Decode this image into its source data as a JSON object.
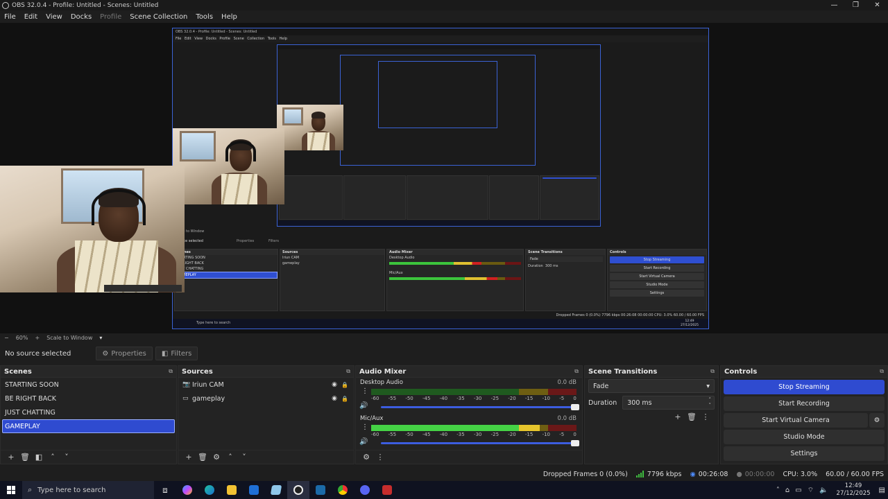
{
  "window": {
    "title": "OBS 32.0.4 - Profile: Untitled - Scenes: Untitled",
    "controls": [
      "—",
      "❐",
      "✕"
    ]
  },
  "menu": {
    "items": [
      "File",
      "Edit",
      "View",
      "Docks",
      "Profile",
      "Scene Collection",
      "Tools",
      "Help"
    ]
  },
  "nested_preview": {
    "title": "OBS 32.0.4 - Profile: Untitled - Scenes: Untitled",
    "menu": "File Edit View Docks Profile Scene Collection Tools Help",
    "zoom": "Scale to Window",
    "no_source": "Source selected",
    "properties": "Properties",
    "filters": "Filters",
    "scenes_header": "Scenes",
    "scenes": [
      "STARTING SOON",
      "BE RIGHT BACK",
      "JUST CHATTING",
      "GAMEPLAY"
    ],
    "sources_header": "Sources",
    "sources": [
      "Iriun CAM",
      "gameplay"
    ],
    "mixer_header": "Audio Mixer",
    "ch1": "Desktop Audio",
    "ch2": "Mic/Aux",
    "db": "0.0 dB",
    "transitions_header": "Scene Transitions",
    "fade": "Fade",
    "duration_label": "Duration",
    "duration_value": "300 ms",
    "controls_header": "Controls",
    "controls": [
      "Stop Streaming",
      "Start Recording",
      "Start Virtual Camera",
      "Studio Mode",
      "Settings"
    ],
    "status": "Dropped Frames 0 (0.0%)   7796 kbps   00:26:08   00:00:00   CPU: 3.0%   60.00 / 60.00 FPS",
    "taskbar_search": "Type here to search",
    "clock_time": "12:49",
    "clock_date": "27/12/2025"
  },
  "zoom_bar": {
    "minus": "−",
    "zoom": "60%",
    "plus": "+",
    "scale_mode": "Scale to Window",
    "dropdown": "▾"
  },
  "selection_bar": {
    "no_source": "No source selected",
    "properties": "Properties",
    "filters": "Filters"
  },
  "scenes": {
    "header": "Scenes",
    "items": [
      "STARTING SOON",
      "BE RIGHT BACK",
      "JUST CHATTING",
      "GAMEPLAY"
    ],
    "selected": "GAMEPLAY"
  },
  "sources": {
    "header": "Sources",
    "items": [
      {
        "name": "Iriun CAM",
        "icon": "camera-icon"
      },
      {
        "name": "gameplay",
        "icon": "monitor-icon"
      }
    ]
  },
  "audio_mixer": {
    "header": "Audio Mixer",
    "ticks": [
      "-60",
      "-55",
      "-50",
      "-45",
      "-40",
      "-35",
      "-30",
      "-25",
      "-20",
      "-15",
      "-10",
      "-5",
      "0"
    ],
    "channels": [
      {
        "name": "Desktop Audio",
        "db": "0.0 dB",
        "level": 0.0,
        "volume": 1.0
      },
      {
        "name": "Mic/Aux",
        "db": "0.0 dB",
        "level": 0.82,
        "volume": 1.0
      }
    ]
  },
  "scene_transitions": {
    "header": "Scene Transitions",
    "transition": "Fade",
    "duration_label": "Duration",
    "duration_value": "300 ms"
  },
  "controls": {
    "header": "Controls",
    "stop_streaming": "Stop Streaming",
    "start_recording": "Start Recording",
    "start_virtual_camera": "Start Virtual Camera",
    "studio_mode": "Studio Mode",
    "settings": "Settings"
  },
  "status": {
    "dropped_frames": "Dropped Frames 0 (0.0%)",
    "bitrate": "7796 kbps",
    "stream_time": "00:26:08",
    "record_time": "00:00:00",
    "cpu": "CPU: 3.0%",
    "fps": "60.00 / 60.00 FPS"
  },
  "taskbar": {
    "search_placeholder": "Type here to search",
    "time": "12:49",
    "date": "27/12/2025"
  },
  "colors": {
    "accent": "#2f4bd0",
    "panel": "#232323",
    "meter_green": "#45d245",
    "meter_yellow": "#e6c52c",
    "meter_red": "#6a1818"
  }
}
